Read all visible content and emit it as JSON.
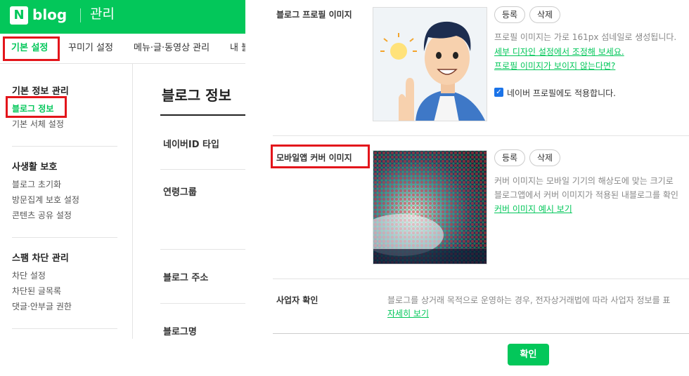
{
  "header": {
    "logo_n": "N",
    "logo_blog": "blog",
    "title": "관리"
  },
  "tabs": [
    {
      "label": "기본 설정"
    },
    {
      "label": "꾸미기 설정"
    },
    {
      "label": "메뉴·글·동영상 관리"
    },
    {
      "label": "내 블"
    }
  ],
  "sidebar": {
    "sections": [
      {
        "title": "기본 정보 관리",
        "items": [
          "블로그 정보",
          "기본 서체 설정"
        ]
      },
      {
        "title": "사생활 보호",
        "items": [
          "블로그 초기화",
          "방문집계 보호 설정",
          "콘텐츠 공유 설정"
        ]
      },
      {
        "title": "스팸 차단 관리",
        "items": [
          "차단 설정",
          "차단된 글목록",
          "댓글·안부글 권한"
        ]
      }
    ]
  },
  "main": {
    "title": "블로그 정보",
    "rows": [
      "네이버ID 타입",
      "연령그룹",
      "블로그 주소",
      "블로그명"
    ]
  },
  "profile": {
    "label": "블로그 프로필 이미지",
    "register": "등록",
    "delete": "삭제",
    "desc": "프로필 이미지는 가로 161px 섬네일로 생성됩니다.",
    "link1": "세부 디자인 설정에서 조정해 보세요.",
    "link2": "프로필 이미지가 보이지 않는다면?",
    "checkbox_label": "네이버 프로필에도 적용합니다."
  },
  "cover": {
    "label": "모바일앱 커버 이미지",
    "register": "등록",
    "delete": "삭제",
    "desc1": "커버 이미지는 모바일 기기의 해상도에 맞는 크기로",
    "desc2": "블로그앱에서 커버 이미지가 적용된 내블로그를 확인",
    "link": "커버 이미지 예시 보기"
  },
  "business": {
    "label": "사업자 확인",
    "desc": "블로그를 상거래 목적으로 운영하는 경우, 전자상거래법에 따라 사업자 정보를 표",
    "link": "자세히 보기"
  },
  "confirm_label": "확인",
  "colors": {
    "brand": "#03c75a",
    "highlight": "#e3151b",
    "checkbox": "#1a73e8"
  }
}
